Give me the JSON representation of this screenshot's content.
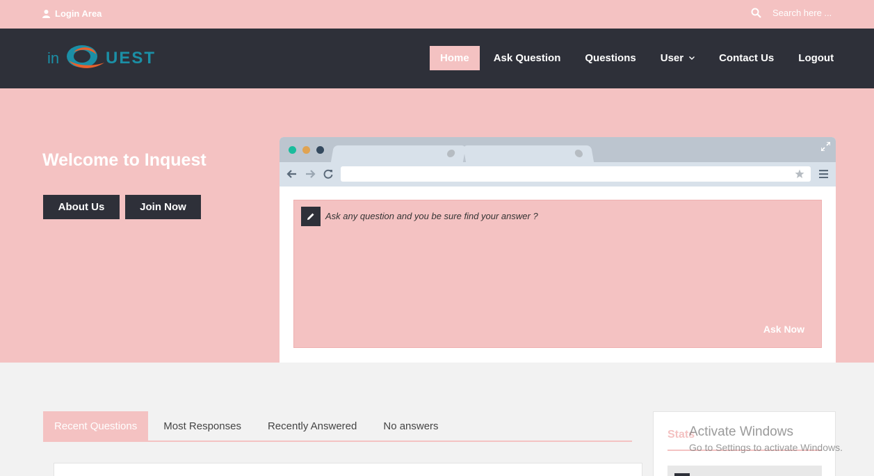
{
  "topbar": {
    "login_label": "Login Area",
    "search_placeholder": "Search here ..."
  },
  "logo": {
    "text_left": "in",
    "text_right": "UEST"
  },
  "nav": {
    "items": [
      {
        "label": "Home",
        "active": true
      },
      {
        "label": "Ask Question"
      },
      {
        "label": "Questions"
      },
      {
        "label": "User",
        "has_dropdown": true
      },
      {
        "label": "Contact Us"
      },
      {
        "label": "Logout"
      }
    ]
  },
  "hero": {
    "welcome": "Welcome to Inquest",
    "about_label": "About Us",
    "join_label": "Join Now",
    "question_prompt": "Ask any question and you be sure find your answer ?",
    "ask_now_label": "Ask Now"
  },
  "tabs": {
    "items": [
      {
        "label": "Recent Questions",
        "active": true
      },
      {
        "label": "Most Responses"
      },
      {
        "label": "Recently Answered"
      },
      {
        "label": "No answers"
      }
    ]
  },
  "widget": {
    "title": "Stats"
  },
  "watermark": {
    "line1": "Activate Windows",
    "line2": "Go to Settings to activate Windows."
  },
  "colors": {
    "accent": "#f4c2c2",
    "dark": "#2e3039",
    "logo_blue": "#1b8fa6",
    "logo_orange": "#e8602c"
  }
}
